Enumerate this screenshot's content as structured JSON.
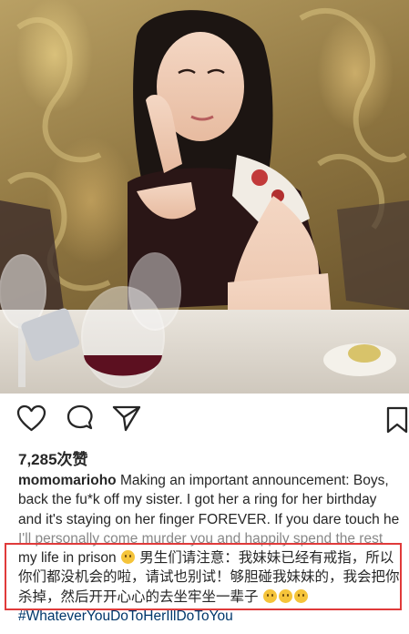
{
  "post": {
    "likes_text": "7,285次赞",
    "username": "momomarioho",
    "caption_lines": [
      " Making an important announcement: Boys,",
      "back the fu*k off my sister. I got her a ring for her birthday",
      "and it's staying on her finger FOREVER. If you dare touch he",
      "I'll personally come murder you and happily spend the rest",
      "my life in prison",
      " 男生们请注意：我妹妹已经有戒指，所以",
      "你们都没机会的啦，请试也别试！够胆碰我妹妹的，我会把你",
      "杀掉，然后开开心心的去坐牢坐一辈子 "
    ],
    "hashtag": "#WhateverYouDoToHerIllDoToYou"
  },
  "actions": {
    "like_icon": "heart-icon",
    "comment_icon": "comment-icon",
    "share_icon": "send-icon",
    "save_icon": "bookmark-icon"
  },
  "colors": {
    "highlight_border": "#e03a3a",
    "hashtag": "#00376b",
    "text": "#262626"
  }
}
